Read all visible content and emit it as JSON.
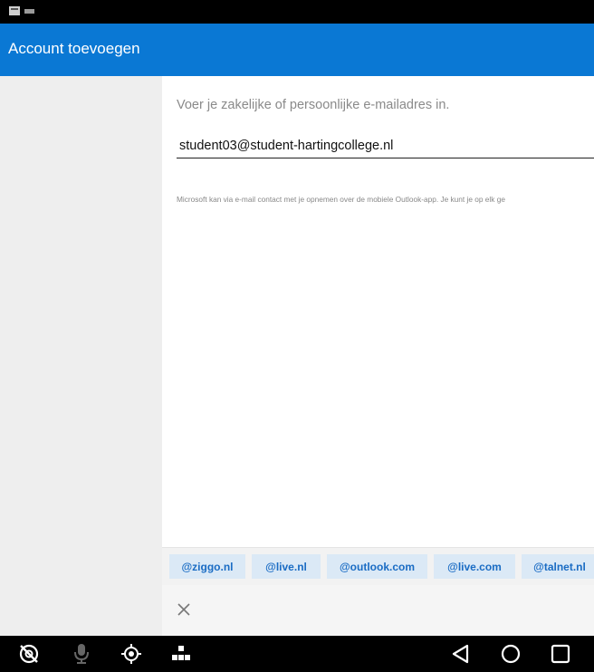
{
  "appbar": {
    "title": "Account toevoegen"
  },
  "form": {
    "prompt": "Voer je zakelijke of persoonlijke e-mailadres in.",
    "email_value": "student03@student-hartingcollege.nl",
    "note": "Microsoft kan via e-mail contact met je opnemen over de mobiele Outlook-app. Je kunt je op elk ge"
  },
  "suggestions": [
    "@ziggo.nl",
    "@live.nl",
    "@outlook.com",
    "@live.com",
    "@talnet.nl"
  ],
  "colors": {
    "appbar": "#0a78d4",
    "chip_bg": "#dbe9f6",
    "chip_text": "#1a6cc4"
  },
  "icons": {
    "status": [
      "keyboard-notification-icon",
      "input-method-icon"
    ],
    "navbar_left": [
      "camera-off-icon",
      "microphone-icon",
      "location-target-icon",
      "apps-grid-icon"
    ],
    "navbar_right": [
      "back-icon",
      "home-icon",
      "recents-icon"
    ],
    "close": "close-icon"
  }
}
